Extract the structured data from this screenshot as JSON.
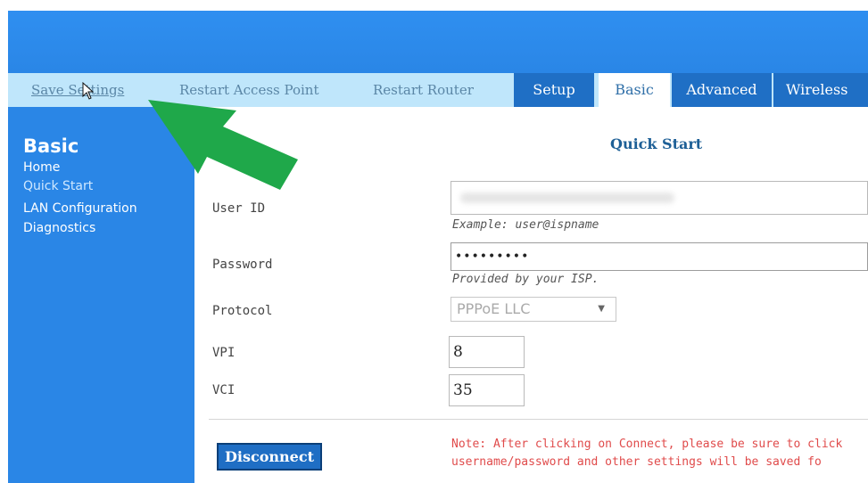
{
  "nav": {
    "links": [
      "Save Settings",
      "Restart Access Point",
      "Restart Router"
    ],
    "tabs": [
      "Setup",
      "Basic",
      "Advanced",
      "Wireless"
    ],
    "active_tab": "Basic"
  },
  "sidebar": {
    "title": "Basic",
    "items": [
      {
        "label": "Home"
      },
      {
        "label": "Quick Start",
        "active": true
      },
      {
        "label": "LAN Configuration"
      },
      {
        "label": "Diagnostics"
      }
    ]
  },
  "main": {
    "title": "Quick Start",
    "fields": {
      "user_id": {
        "label": "User ID",
        "hint": "Example: user@ispname",
        "value": ""
      },
      "password": {
        "label": "Password",
        "hint": "Provided by your ISP.",
        "value": "•••••••••"
      },
      "protocol": {
        "label": "Protocol",
        "value": "PPPoE LLC"
      },
      "vpi": {
        "label": "VPI",
        "value": "8"
      },
      "vci": {
        "label": "VCI",
        "value": "35"
      }
    },
    "disconnect_label": "Disconnect",
    "note_line1": "Note: After clicking on Connect, please be sure to click",
    "note_line2": "username/password and other settings will be saved fo"
  },
  "colors": {
    "brand_blue": "#2a86e6",
    "tab_blue": "#1f6fc5",
    "nav_light": "#bfe6fb",
    "annotation_green": "#1fa84a",
    "note_red": "#e04b4b"
  },
  "icons": [
    "arrow-annotation-icon",
    "mouse-cursor-icon",
    "chevron-down-icon"
  ]
}
